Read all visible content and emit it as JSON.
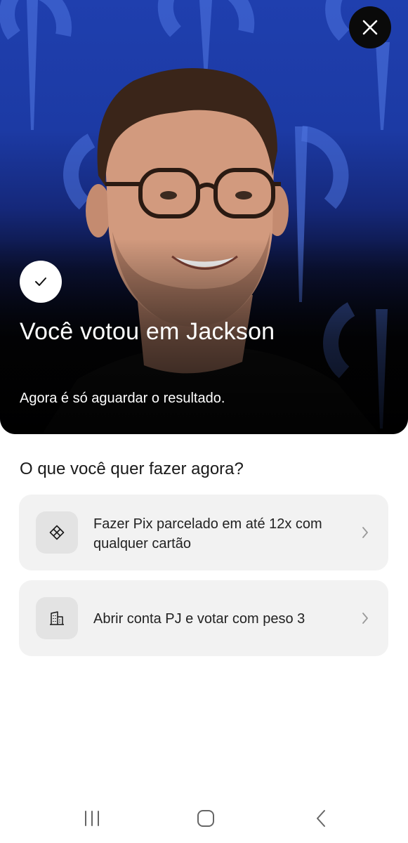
{
  "hero": {
    "title": "Você votou em Jackson",
    "subtitle": "Agora é só aguardar o resultado.",
    "close_icon": "close-icon",
    "check_icon": "checkmark-icon"
  },
  "main": {
    "question": "O que você quer fazer agora?",
    "options": [
      {
        "label": "Fazer Pix parcelado em até 12x com qualquer cartão",
        "icon": "pix-icon"
      },
      {
        "label": "Abrir conta PJ e votar com peso 3",
        "icon": "building-icon"
      }
    ]
  },
  "navbar": {
    "items": [
      "recent-apps-icon",
      "home-icon",
      "back-icon"
    ]
  },
  "colors": {
    "hero_blue": "#1f3fae",
    "card_bg": "#f2f2f2",
    "text": "#1a1a1a"
  }
}
